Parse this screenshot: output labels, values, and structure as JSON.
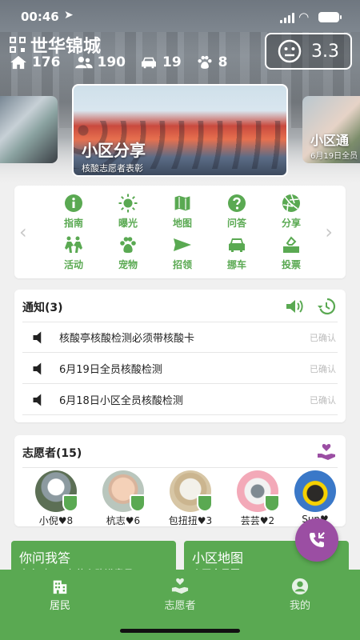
{
  "status_bar": {
    "time": "00:46",
    "location_icon": "location-arrow-icon",
    "signal_icon": "signal-icon",
    "wifi_icon": "wifi-icon",
    "battery_icon": "battery-icon"
  },
  "header": {
    "community_name": "世华锦城",
    "qr_icon": "qr-code-icon",
    "stats": [
      {
        "icon": "home-icon",
        "value": "176"
      },
      {
        "icon": "people-icon",
        "value": "190"
      },
      {
        "icon": "car-icon",
        "value": "19"
      },
      {
        "icon": "paw-icon",
        "value": "8"
      }
    ],
    "score": {
      "icon": "face-icon",
      "value": "3.3"
    }
  },
  "carousel": {
    "center": {
      "title": "小区分享",
      "subtitle": "核酸志愿者表彰"
    },
    "right": {
      "title": "小区通",
      "subtitle": "6月19日全员"
    }
  },
  "menu": {
    "items": [
      {
        "label": "指南",
        "icon": "info-icon"
      },
      {
        "label": "曝光",
        "icon": "sun-icon"
      },
      {
        "label": "地图",
        "icon": "map-icon"
      },
      {
        "label": "问答",
        "icon": "question-icon"
      },
      {
        "label": "分享",
        "icon": "aperture-icon"
      },
      {
        "label": "活动",
        "icon": "activity-icon"
      },
      {
        "label": "宠物",
        "icon": "paw-icon"
      },
      {
        "label": "招领",
        "icon": "send-icon"
      },
      {
        "label": "挪车",
        "icon": "car-icon"
      },
      {
        "label": "投票",
        "icon": "vote-icon"
      }
    ]
  },
  "notices": {
    "title": "通知(3)",
    "items": [
      {
        "text": "核酸亭核酸检测必须带核酸卡",
        "status": "已确认"
      },
      {
        "text": "6月19日全员核酸检测",
        "status": "已确认"
      },
      {
        "text": "6月18日小区全员核酸检测",
        "status": "已确认"
      }
    ]
  },
  "volunteers": {
    "title": "志愿者(15)",
    "items": [
      {
        "name": "小倪♥8"
      },
      {
        "name": "杭志♥6"
      },
      {
        "name": "包扭扭♥3"
      },
      {
        "name": "芸芸♥2"
      },
      {
        "name": "Sun♥"
      }
    ]
  },
  "quick_cards": [
    {
      "title": "你问我答",
      "subtitle": "大家对APP有什么改进意见?"
    },
    {
      "title": "小区地图",
      "subtitle": "小区全景图"
    }
  ],
  "tabbar": {
    "tabs": [
      {
        "label": "居民",
        "icon": "building-icon",
        "active": true
      },
      {
        "label": "志愿者",
        "icon": "heart-hand-icon",
        "active": false
      },
      {
        "label": "我的",
        "icon": "user-icon",
        "active": false
      }
    ]
  },
  "colors": {
    "accent": "#5aa952",
    "fab": "#9b4ea3"
  }
}
